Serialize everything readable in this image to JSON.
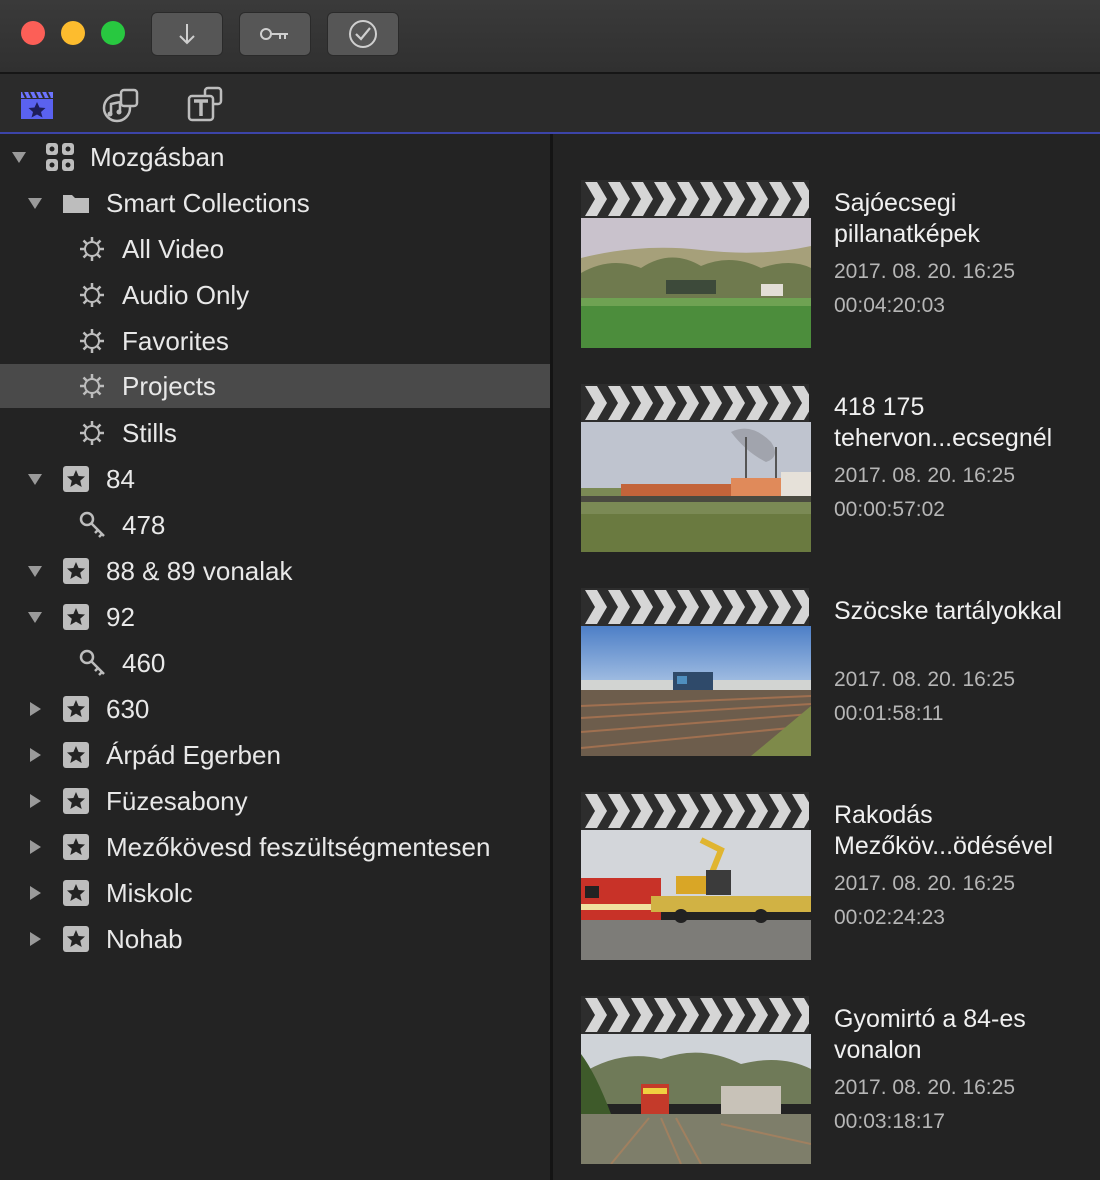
{
  "toolbar": {
    "import_icon": "down-arrow-icon",
    "keyword_icon": "key-icon",
    "check_icon": "checkmark-circle-icon"
  },
  "tabs": {
    "libraries": "clapperboard-star-icon",
    "photos_audio": "music-photo-icon",
    "titles": "title-T-icon",
    "accent": "#3c44a8"
  },
  "sidebar": {
    "library": "Mozgásban",
    "smart_collections": "Smart Collections",
    "collections": [
      "All Video",
      "Audio Only",
      "Favorites",
      "Projects",
      "Stills"
    ],
    "selected": "Projects",
    "events": [
      {
        "label": "84",
        "expanded": true,
        "children": [
          "478"
        ]
      },
      {
        "label": "88 & 89 vonalak",
        "expanded": true,
        "children": []
      },
      {
        "label": "92",
        "expanded": true,
        "children": [
          "460"
        ]
      },
      {
        "label": "630",
        "expanded": false
      },
      {
        "label": "Árpád Egerben",
        "expanded": false
      },
      {
        "label": "Füzesabony",
        "expanded": false
      },
      {
        "label": "Mezőkövesd feszültségmentesen",
        "expanded": false
      },
      {
        "label": "Miskolc",
        "expanded": false
      },
      {
        "label": "Nohab",
        "expanded": false
      }
    ]
  },
  "clips": [
    {
      "title": "Sajóecsegi pillanatképek",
      "date": "2017. 08. 20. 16:25",
      "duration": "00:04:20:03"
    },
    {
      "title": "418 175 tehervon...ecsegnél",
      "date": "2017. 08. 20. 16:25",
      "duration": "00:00:57:02"
    },
    {
      "title": "Szöcske tartályokkal",
      "date": "2017. 08. 20. 16:25",
      "duration": "00:01:58:11"
    },
    {
      "title": "Rakodás Mezőköv...ödésével",
      "date": "2017. 08. 20. 16:25",
      "duration": "00:02:24:23"
    },
    {
      "title": "Gyomirtó a 84-es vonalon",
      "date": "2017. 08. 20. 16:25",
      "duration": "00:03:18:17"
    }
  ]
}
